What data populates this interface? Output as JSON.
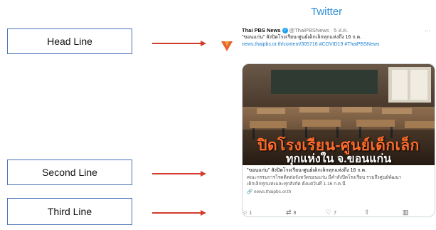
{
  "labels": {
    "head": "Head Line",
    "second": "Second Line",
    "third": "Third Line"
  },
  "platform_title": "Twitter",
  "tweet": {
    "author_name": "Thai PBS News",
    "verified_glyph": "✓",
    "handle_time": "@ThaiPBSNews · 5 ส.ค.",
    "more_glyph": "···",
    "text": "\"ขอนแก่น\" สั่งปิดโรงเรียน-ศูนย์เด็กเล็กทุกแห่งถึง 16 ก.ค.",
    "links": "news.thaipbs.or.th/content/305716 #COVID19 #ThaiPBSNews",
    "card": {
      "overlay_line1": "ปิดโรงเรียน-ศูนย์เด็กเล็ก",
      "overlay_line2": "ทุกแห่งใน จ.ขอนแก่น",
      "title": "\"ขอนแก่น\" สั่งปิดโรงเรียน-ศูนย์เด็กเล็กทุกแห่งถึง 16 ก.ค.",
      "desc_line1": "คณะกรรมการโรคติดต่อจังหวัดขอนแก่น มีคำสั่งปิดโรงเรียน รวมถึงศูนย์พัฒนา",
      "desc_line2": "เด็กเล็กทุกแห่งและทุกสังกัด ตั้งแต่วันที่ 1-16 ก.ค.นี้",
      "domain": "🔗 news.thaipbs.or.th"
    },
    "actions": {
      "reply_count": "1",
      "retweet_count": "8",
      "like_count": "7"
    }
  },
  "colors": {
    "accent": "#2f8fd8",
    "arrow": "#d33b2c",
    "box_border": "#4a72b8"
  },
  "icons": [
    "avatar-logo-icon",
    "verified-icon",
    "more-icon",
    "reply-icon",
    "retweet-icon",
    "like-icon",
    "share-icon",
    "analytics-icon"
  ]
}
